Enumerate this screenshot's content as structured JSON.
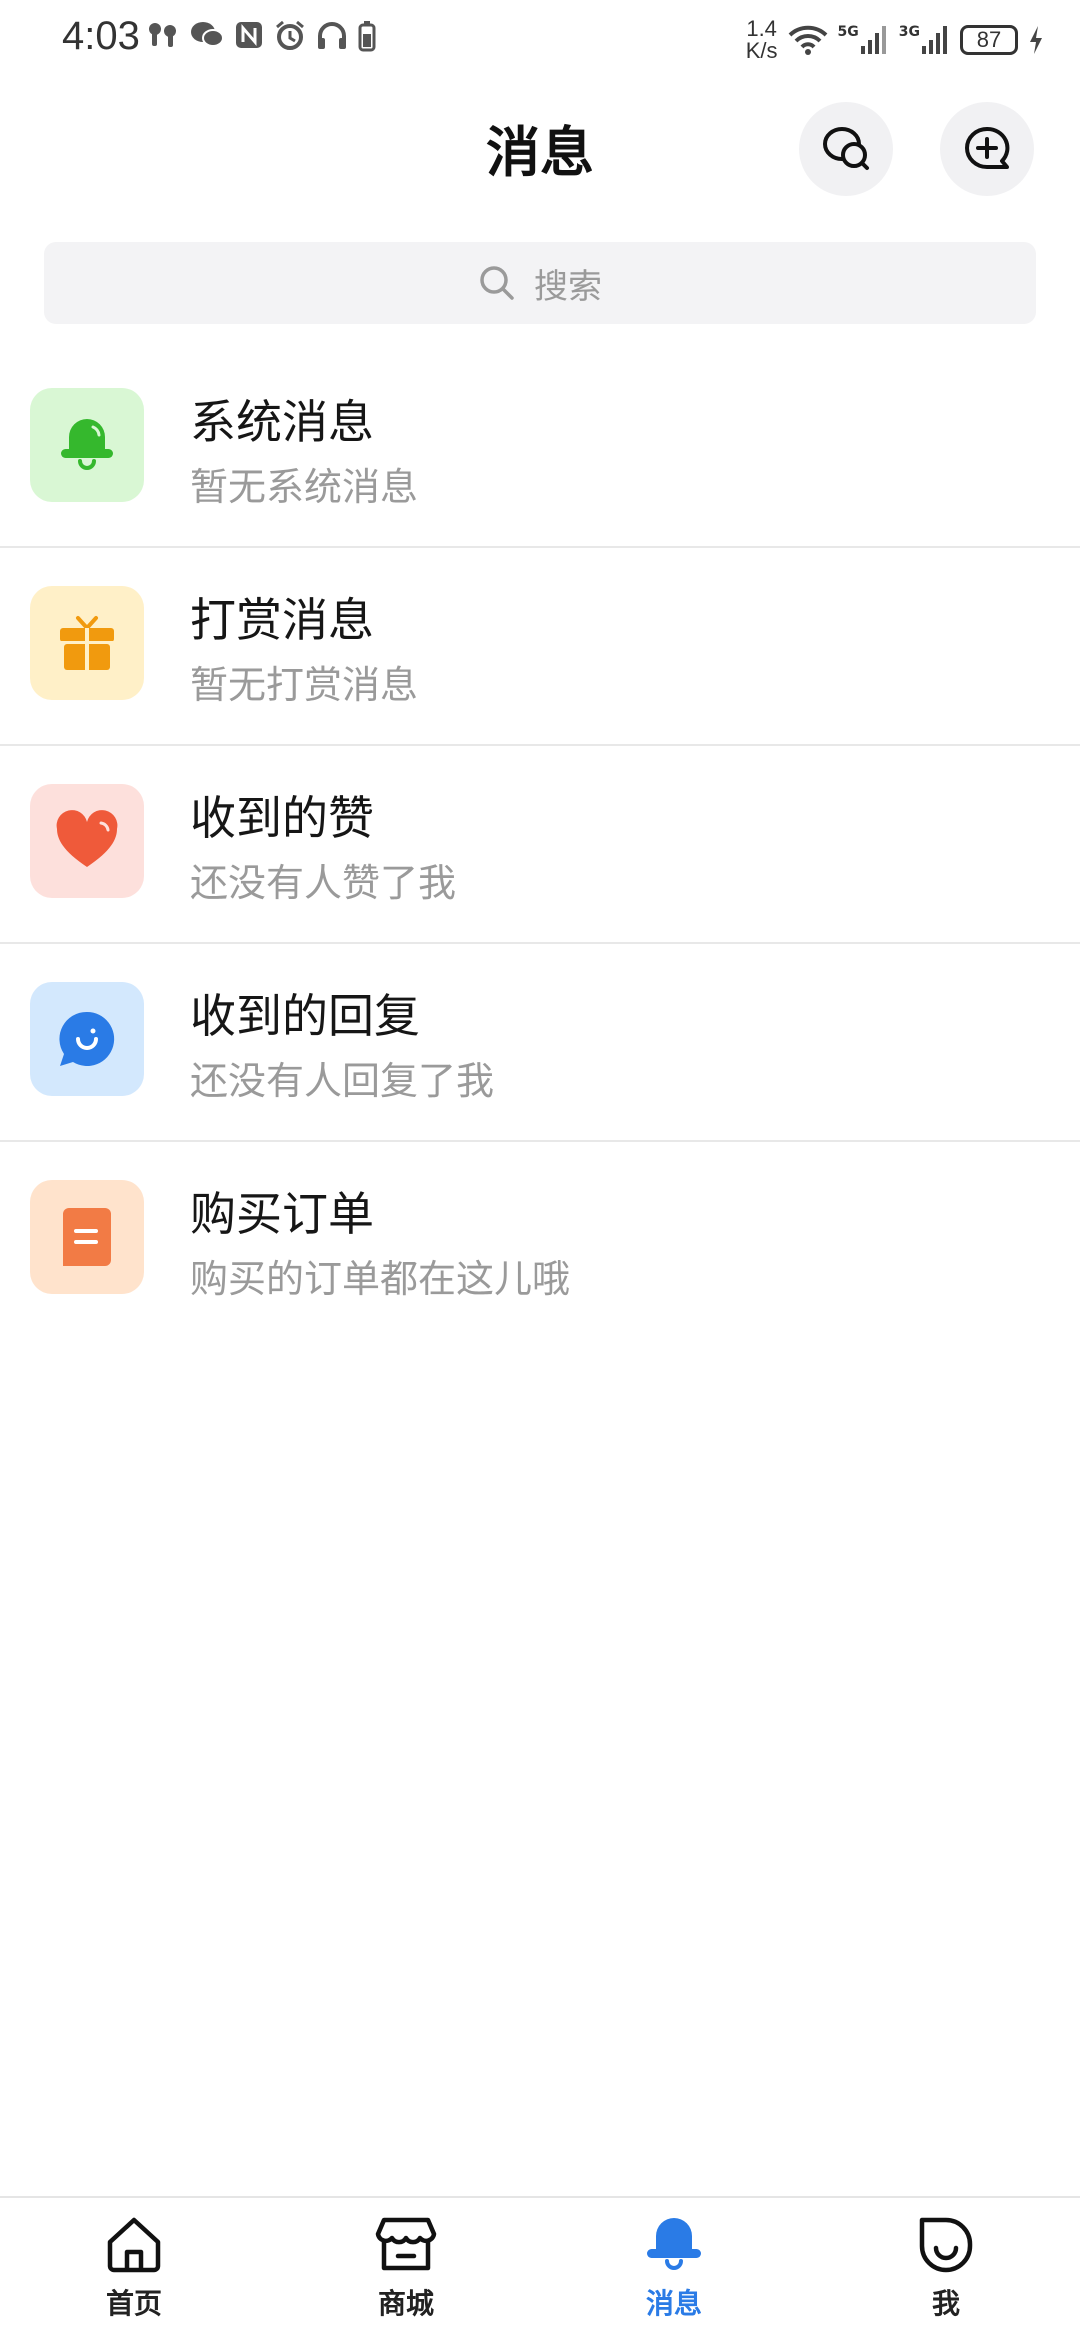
{
  "status_bar": {
    "time": "4:03",
    "net_speed_value": "1.4",
    "net_speed_unit": "K/s",
    "signal1_label": "5G",
    "signal2_label": "3G",
    "battery": "87"
  },
  "header": {
    "title": "消息"
  },
  "search": {
    "placeholder": "搜索"
  },
  "messages": [
    {
      "title": "系统消息",
      "subtitle": "暂无系统消息",
      "icon": "bell-icon",
      "bg": "#d9f7d4",
      "fg": "#35b82d"
    },
    {
      "title": "打赏消息",
      "subtitle": "暂无打赏消息",
      "icon": "gift-icon",
      "bg": "#fff0c8",
      "fg": "#f19a0e"
    },
    {
      "title": "收到的赞",
      "subtitle": "还没有人赞了我",
      "icon": "heart-icon",
      "bg": "#fde0dc",
      "fg": "#ef5a3a"
    },
    {
      "title": "收到的回复",
      "subtitle": "还没有人回复了我",
      "icon": "reply-bubble-icon",
      "bg": "#d3e8fd",
      "fg": "#2a7be6"
    },
    {
      "title": "购买订单",
      "subtitle": "购买的订单都在这儿哦",
      "icon": "order-doc-icon",
      "bg": "#ffe3cc",
      "fg": "#f27b45"
    }
  ],
  "bottom_nav": [
    {
      "label": "首页",
      "icon": "home-icon",
      "active": false
    },
    {
      "label": "商城",
      "icon": "store-icon",
      "active": false
    },
    {
      "label": "消息",
      "icon": "bell-icon",
      "active": true
    },
    {
      "label": "我",
      "icon": "profile-icon",
      "active": false
    }
  ],
  "colors": {
    "accent": "#2a7be6",
    "divider": "#e8e8e8",
    "subtitle": "#9a9a9a"
  }
}
